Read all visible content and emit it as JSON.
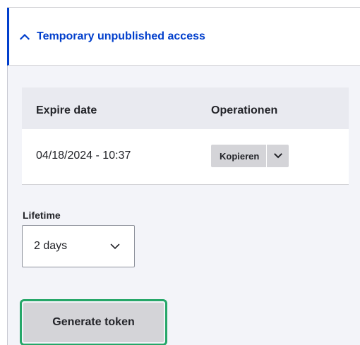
{
  "details": {
    "summary_title": "Temporary unpublished access",
    "summary_icon": "chevron-up-icon"
  },
  "table": {
    "headers": [
      "Expire date",
      "Operationen"
    ],
    "rows": [
      {
        "expire_date": "04/18/2024 - 10:37",
        "operation_label": "Kopieren"
      }
    ]
  },
  "lifetime": {
    "label": "Lifetime",
    "selected": "2 days"
  },
  "generate": {
    "label": "Generate token"
  },
  "colors": {
    "accent": "#003ecc",
    "focus_ring": "#26a769",
    "button_bg": "#d4d4d8",
    "panel_bg": "#f3f4f9"
  }
}
